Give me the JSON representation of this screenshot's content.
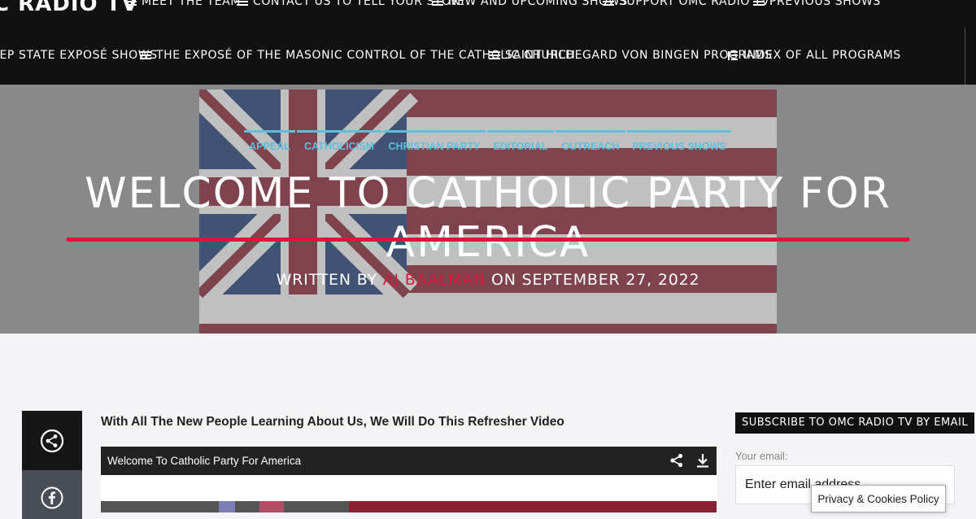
{
  "header": {
    "logo": "C RADIO TV",
    "nav_row1": [
      {
        "label": "MEET THE TEAM",
        "icon": "menu-lines-icon"
      },
      {
        "label": "CONTACT US TO TELL YOUR STORY",
        "icon": "menu-lines-icon"
      },
      {
        "label": "NEW AND UPCOMING SHOWS",
        "icon": "menu-lines-icon"
      },
      {
        "label": "SUPPORT OMC RADIO TV",
        "icon": "menu-lines-icon"
      },
      {
        "label": "PREVIOUS SHOWS",
        "icon": "menu-lines-icon"
      }
    ],
    "nav_row2": [
      {
        "label": "EEP STATE EXPOSÉ SHOWS",
        "icon": "menu-lines-icon"
      },
      {
        "label": "THE EXPOSÉ OF THE MASONIC CONTROL OF THE CATHOLIC CHURCH",
        "icon": "menu-lines-icon"
      },
      {
        "label": "SAINT HILDEGARD VON BINGEN PROGRAMS",
        "icon": "menu-lines-icon"
      },
      {
        "label": "INDEX OF ALL PROGRAMS",
        "icon": "index-icon"
      }
    ]
  },
  "hero": {
    "categories": [
      "APPEAL",
      "CATHOLICISM",
      "CHRISTIAN PARTY",
      "EDITORIAL",
      "OUTREACH",
      "PREVIOUS SHOWS"
    ],
    "title": "WELCOME TO CATHOLIC PARTY FOR AMERICA",
    "byline_prefix": "WRITTEN BY ",
    "author": "AJ BAALMAN",
    "byline_suffix": " ON SEPTEMBER 27, 2022",
    "accent_color": "#d6183c",
    "category_color": "#5bc0de"
  },
  "article": {
    "intro": "With All The New People Learning About Us, We Will Do This Refresher Video",
    "video_title": "Welcome To Catholic Party For America"
  },
  "sidebar": {
    "subscribe_heading": "SUBSCRIBE TO OMC RADIO TV BY EMAIL",
    "email_label": "Your email:",
    "email_placeholder": "Enter email address..."
  },
  "cookie_button": "Privacy & Cookies Policy"
}
